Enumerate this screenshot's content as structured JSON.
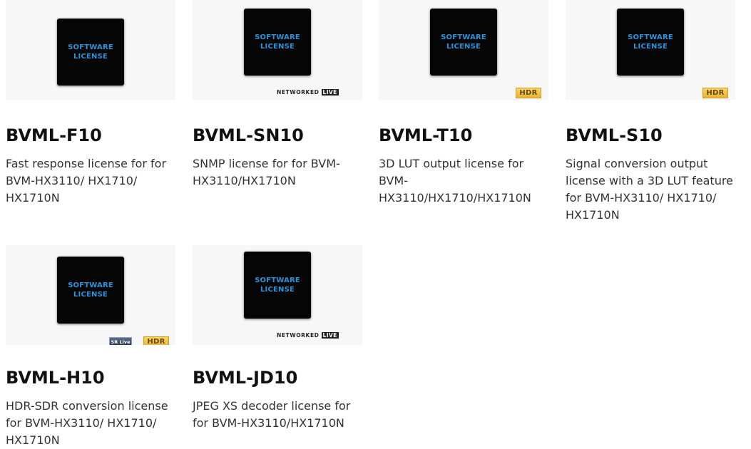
{
  "products": [
    {
      "model": "BVML-F10",
      "description": "Fast response license for for BVM-HX3110/ HX1710/ HX1710N",
      "image": {
        "line1": "SOFTWARE",
        "line2": "LICENSE",
        "badges": []
      }
    },
    {
      "model": "BVML-SN10",
      "description": "SNMP license for for BVM-HX3110/HX1710N",
      "image": {
        "line1": "SOFTWARE",
        "line2": "LICENSE",
        "badges": [
          "NETWORKED LIVE"
        ]
      }
    },
    {
      "model": "BVML-T10",
      "description": "3D LUT output license for BVM-HX3110/HX1710/HX1710N",
      "image": {
        "line1": "SOFTWARE",
        "line2": "LICENSE",
        "badges": [
          "HDR"
        ]
      }
    },
    {
      "model": "BVML-S10",
      "description": "Signal conversion output license with a 3D LUT feature for BVM-HX3110/ HX1710/ HX1710N",
      "image": {
        "line1": "SOFTWARE",
        "line2": "LICENSE",
        "badges": [
          "HDR"
        ]
      }
    },
    {
      "model": "BVML-H10",
      "description": "HDR-SDR conversion license for BVM-HX3110/ HX1710/ HX1710N",
      "image": {
        "line1": "SOFTWARE",
        "line2": "LICENSE",
        "badges": [
          "SR Live",
          "HDR"
        ]
      }
    },
    {
      "model": "BVML-JD10",
      "description": "JPEG XS decoder license for for BVM-HX3110/HX1710N",
      "image": {
        "line1": "SOFTWARE",
        "line2": "LICENSE",
        "badges": [
          "NETWORKED LIVE"
        ]
      }
    }
  ],
  "badge_text": {
    "networked": "NETWORKED",
    "live": "LIVE",
    "hdr": "HDR",
    "srlive": "SR Live"
  },
  "colors": {
    "license_text": "#2f93d9",
    "box": "#050505",
    "hdr_badge": "#e8b33a"
  }
}
